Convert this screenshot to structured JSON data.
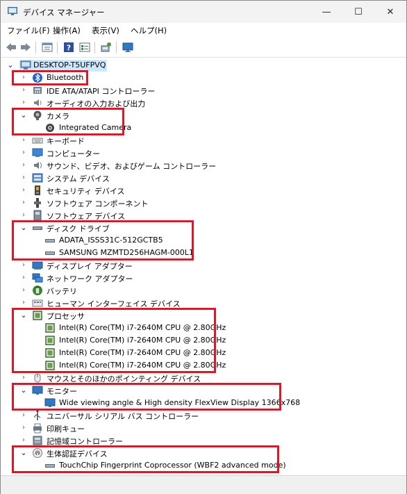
{
  "window": {
    "title": "デバイス マネージャー",
    "controls": {
      "minimize": "—",
      "maximize": "☐",
      "close": "✕"
    }
  },
  "menu": [
    "ファイル(F)",
    "操作(A)",
    "表示(V)",
    "ヘルプ(H)"
  ],
  "toolbar": [
    "back-icon",
    "forward-icon",
    "properties-icon",
    "help-icon",
    "device-view-icon",
    "scan-hardware-icon",
    "monitor-icon"
  ],
  "tree": {
    "root": "DESKTOP-T5UFPVQ",
    "items": [
      {
        "label": "Bluetooth",
        "icon": "bluetooth-icon",
        "expanded": false,
        "children": []
      },
      {
        "label": "IDE ATA/ATAPI コントローラー",
        "icon": "ide-controller-icon",
        "expanded": false,
        "children": []
      },
      {
        "label": "オーディオの入力および出力",
        "icon": "audio-io-icon",
        "expanded": false,
        "children": []
      },
      {
        "label": "カメラ",
        "icon": "camera-icon",
        "expanded": true,
        "children": [
          "Integrated Camera"
        ]
      },
      {
        "label": "キーボード",
        "icon": "keyboard-icon",
        "expanded": false,
        "children": []
      },
      {
        "label": "コンピューター",
        "icon": "computer-icon",
        "expanded": false,
        "children": []
      },
      {
        "label": "サウンド、ビデオ、およびゲーム コントローラー",
        "icon": "sound-icon",
        "expanded": false,
        "children": []
      },
      {
        "label": "システム デバイス",
        "icon": "system-device-icon",
        "expanded": false,
        "children": []
      },
      {
        "label": "セキュリティ デバイス",
        "icon": "security-device-icon",
        "expanded": false,
        "children": []
      },
      {
        "label": "ソフトウェア コンポーネント",
        "icon": "software-component-icon",
        "expanded": false,
        "children": []
      },
      {
        "label": "ソフトウェア デバイス",
        "icon": "software-device-icon",
        "expanded": false,
        "children": []
      },
      {
        "label": "ディスク ドライブ",
        "icon": "disk-drive-icon",
        "expanded": true,
        "children": [
          "ADATA_ISSS31C-512GCTB5",
          "SAMSUNG MZMTD256HAGM-000L1"
        ]
      },
      {
        "label": "ディスプレイ アダプター",
        "icon": "display-adapter-icon",
        "expanded": false,
        "children": []
      },
      {
        "label": "ネットワーク アダプター",
        "icon": "network-adapter-icon",
        "expanded": false,
        "children": []
      },
      {
        "label": "バッテリ",
        "icon": "battery-icon",
        "expanded": false,
        "children": []
      },
      {
        "label": "ヒューマン インターフェイス デバイス",
        "icon": "hid-icon",
        "expanded": false,
        "children": []
      },
      {
        "label": "プロセッサ",
        "icon": "processor-icon",
        "expanded": true,
        "children": [
          "Intel(R) Core(TM) i7-2640M CPU @ 2.80GHz",
          "Intel(R) Core(TM) i7-2640M CPU @ 2.80GHz",
          "Intel(R) Core(TM) i7-2640M CPU @ 2.80GHz",
          "Intel(R) Core(TM) i7-2640M CPU @ 2.80GHz"
        ]
      },
      {
        "label": "マウスとそのほかのポインティング デバイス",
        "icon": "mouse-icon",
        "expanded": false,
        "children": []
      },
      {
        "label": "モニター",
        "icon": "monitor-icon",
        "expanded": true,
        "children": [
          "Wide viewing angle & High density FlexView Display 1366x768"
        ]
      },
      {
        "label": "ユニバーサル シリアル バス コントローラー",
        "icon": "usb-icon",
        "expanded": false,
        "children": []
      },
      {
        "label": "印刷キュー",
        "icon": "print-queue-icon",
        "expanded": false,
        "children": []
      },
      {
        "label": "記憶域コントローラー",
        "icon": "storage-controller-icon",
        "expanded": false,
        "children": []
      },
      {
        "label": "生体認証デバイス",
        "icon": "biometric-icon",
        "expanded": true,
        "children": [
          "TouchChip Fingerprint Coprocessor (WBF2 advanced mode)"
        ]
      }
    ]
  },
  "colors": {
    "highlight_border": "#d7192a",
    "selection": "#cce8ff",
    "titlebar": "#f3f3f3"
  }
}
